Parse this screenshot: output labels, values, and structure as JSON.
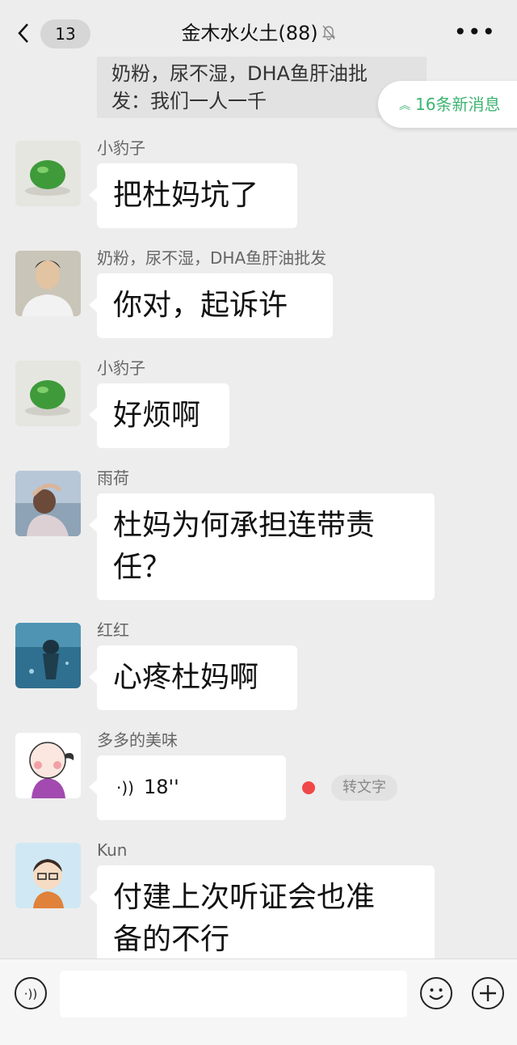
{
  "header": {
    "back_count": "13",
    "title": "金木水火土(88)"
  },
  "top_fragment": {
    "line1": "奶粉，尿不湿，DHA鱼肝油批",
    "line2": "发：我们一人一千"
  },
  "new_messages": "16条新消息",
  "messages": [
    {
      "sender": "小豹子",
      "text": "把杜妈坑了",
      "avatar": "green-ball-avatar"
    },
    {
      "sender": "奶粉，尿不湿，DHA鱼肝油批发",
      "text": "你对，起诉许",
      "avatar": "woman-portrait-avatar"
    },
    {
      "sender": "小豹子",
      "text": "好烦啊",
      "avatar": "green-ball-avatar"
    },
    {
      "sender": "雨荷",
      "text": "杜妈为何承担连带责任？",
      "line1": "杜妈为何承担连带责",
      "line2": "任？",
      "avatar": "woman-back-view-avatar"
    },
    {
      "sender": "红红",
      "text": "心疼杜妈啊",
      "avatar": "diver-underwater-avatar"
    },
    {
      "sender": "多多的美味",
      "voice_duration": "18''",
      "to_text": "转文字",
      "avatar": "cartoon-girl-avatar"
    },
    {
      "sender": "Kun",
      "line1": "付建上次听证会也准",
      "line2": "备的不行",
      "avatar": "cartoon-glasses-avatar"
    }
  ],
  "colors": {
    "background": "#ededed",
    "bubble": "#ffffff",
    "accent_green": "#3cb371",
    "unread_dot": "#f04848"
  }
}
